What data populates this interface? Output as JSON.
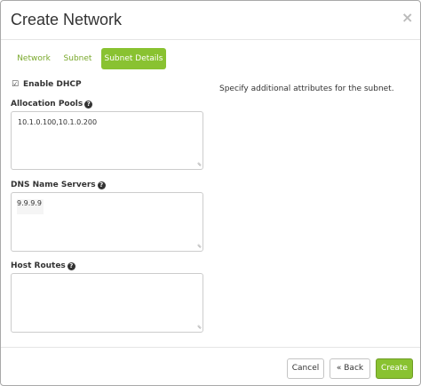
{
  "dialog": {
    "title": "Create Network",
    "close_symbol": "×"
  },
  "tabs": [
    {
      "label": "Network",
      "active": false
    },
    {
      "label": "Subnet",
      "active": false
    },
    {
      "label": "Subnet Details",
      "active": true
    }
  ],
  "form": {
    "enable_dhcp": {
      "label": "Enable DHCP",
      "checked": true,
      "check_symbol": "☑"
    },
    "allocation_pools": {
      "label": "Allocation Pools",
      "value": "10.1.0.100,10.1.0.200"
    },
    "dns_name_servers": {
      "label": "DNS Name Servers",
      "value": "9.9.9.9"
    },
    "host_routes": {
      "label": "Host Routes",
      "value": ""
    },
    "help_symbol": "?"
  },
  "description": "Specify additional attributes for the subnet.",
  "footer": {
    "cancel_label": "Cancel",
    "back_label": "« Back",
    "create_label": "Create"
  },
  "colors": {
    "accent": "#89c231",
    "tab_link": "#79a82b"
  }
}
